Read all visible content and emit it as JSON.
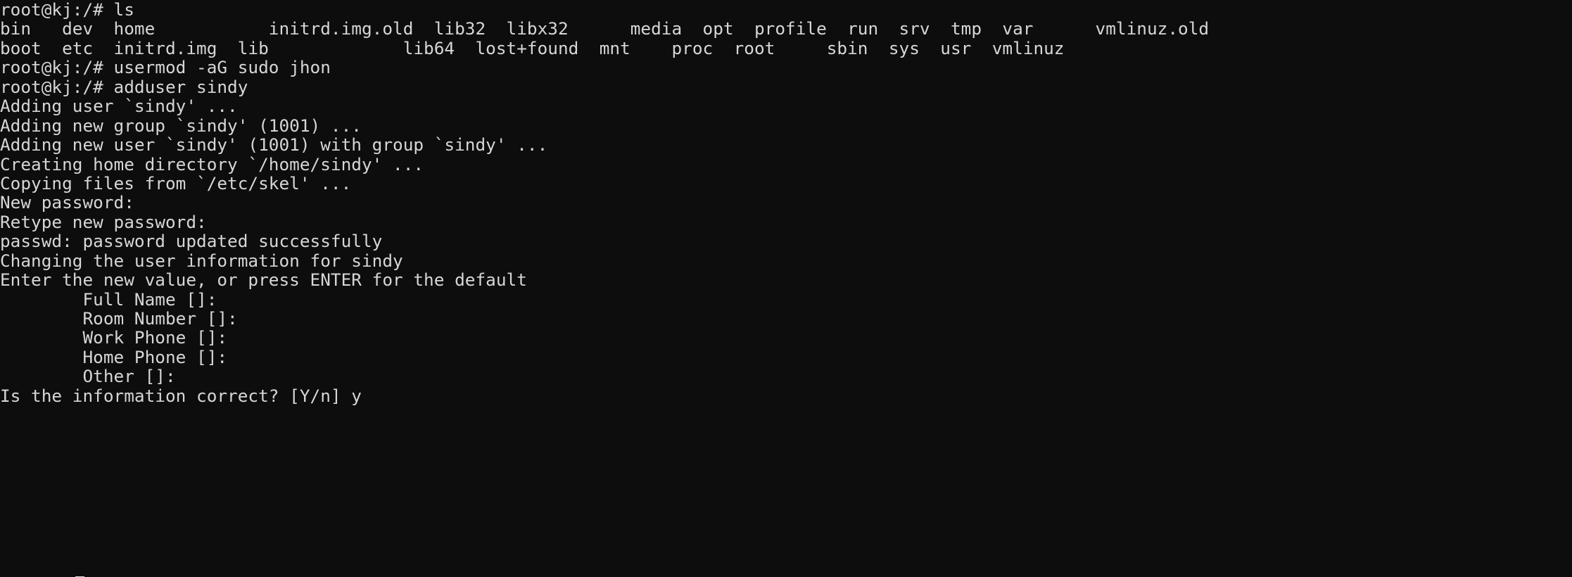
{
  "terminal": {
    "background_color": "#0d0d0d",
    "foreground_color": "#d6d6d6",
    "prompt": "root@kj:/#",
    "cursor": {
      "visible": true,
      "style": "underline",
      "column": 8
    },
    "lines": [
      "root@kj:/# ls",
      "bin   dev  home           initrd.img.old  lib32  libx32      media  opt  profile  run  srv  tmp  var      vmlinuz.old",
      "boot  etc  initrd.img  lib             lib64  lost+found  mnt    proc  root     sbin  sys  usr  vmlinuz",
      "root@kj:/# usermod -aG sudo jhon",
      "root@kj:/# adduser sindy",
      "Adding user `sindy' ...",
      "Adding new group `sindy' (1001) ...",
      "Adding new user `sindy' (1001) with group `sindy' ...",
      "Creating home directory `/home/sindy' ...",
      "Copying files from `/etc/skel' ...",
      "New password:",
      "Retype new password:",
      "passwd: password updated successfully",
      "Changing the user information for sindy",
      "Enter the new value, or press ENTER for the default",
      "        Full Name []:",
      "        Room Number []:",
      "        Work Phone []:",
      "        Home Phone []:",
      "        Other []:",
      "Is the information correct? [Y/n] y"
    ]
  },
  "session": {
    "user": "root",
    "host": "kj",
    "cwd": "/",
    "commands": [
      "ls",
      "usermod -aG sudo jhon",
      "adduser sindy"
    ],
    "new_user": "sindy",
    "new_user_uid": "1001",
    "new_group": "sindy",
    "new_group_gid": "1001",
    "home_directory": "/home/sindy",
    "skel_directory": "/etc/skel",
    "modified_user": "jhon",
    "added_group": "sudo",
    "confirmation_answer": "y"
  },
  "ls_output": {
    "row1": [
      "bin",
      "dev",
      "home",
      "initrd.img.old",
      "lib32",
      "libx32",
      "media",
      "opt",
      "profile",
      "run",
      "srv",
      "tmp",
      "var",
      "vmlinuz.old"
    ],
    "row2": [
      "boot",
      "etc",
      "initrd.img",
      "lib",
      "lib64",
      "lost+found",
      "mnt",
      "proc",
      "root",
      "sbin",
      "sys",
      "usr",
      "vmlinuz"
    ]
  },
  "chfn_fields": [
    "Full Name []:",
    "Room Number []:",
    "Work Phone []:",
    "Home Phone []:",
    "Other []:"
  ]
}
